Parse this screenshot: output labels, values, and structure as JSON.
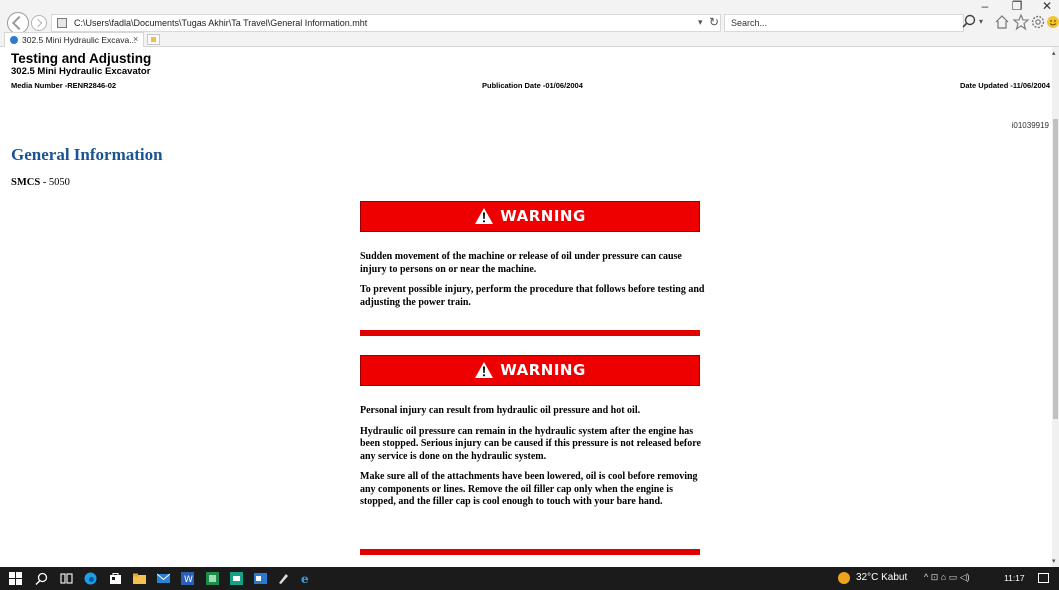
{
  "browser": {
    "address": "C:\\Users\\fadla\\Documents\\Tugas Akhir\\Ta Travel\\General Information.mht",
    "search_placeholder": "Search...",
    "tab_title": "302.5 Mini Hydraulic Excava...",
    "tab_close": "×",
    "window_controls": {
      "minimize": "–",
      "restore": "❐",
      "close": "✕"
    }
  },
  "document": {
    "heading": "Testing and Adjusting",
    "subheading": "302.5 Mini Hydraulic Excavator",
    "media_number": "Media Number -RENR2846-02",
    "publication_date": "Publication Date -01/06/2004",
    "date_updated": "Date Updated -11/06/2004",
    "image_id": "i01039919",
    "section_title": "General Information",
    "smcs_label": "SMCS",
    "smcs_value": " - 5050",
    "warnings": [
      {
        "label": "WARNING",
        "paragraphs": [
          "Sudden movement of the machine or release of oil under pressure can cause injury to persons on or near the machine.",
          "To prevent possible injury, perform the procedure that follows before testing and adjusting the power train."
        ]
      },
      {
        "label": "WARNING",
        "paragraphs": [
          "Personal injury can result from hydraulic oil pressure and hot oil.",
          "Hydraulic oil pressure can remain in the hydraulic system after the engine has been stopped. Serious injury can be caused if this pressure is not released before any service is done on the hydraulic system.",
          "Make sure all of the attachments have been lowered, oil is cool before removing any components or lines. Remove the oil filler cap only when the engine is stopped, and the filler cap is cool enough to touch with your bare hand."
        ]
      }
    ]
  },
  "taskbar": {
    "weather": "32°C  Kabut",
    "tray": "^  ⊡  ⌂  ▭  ◁)",
    "time": "11:17"
  },
  "colors": {
    "warning_red": "#ee0000",
    "section_title_blue": "#1a5493",
    "taskbar": "#1b1b1b"
  }
}
